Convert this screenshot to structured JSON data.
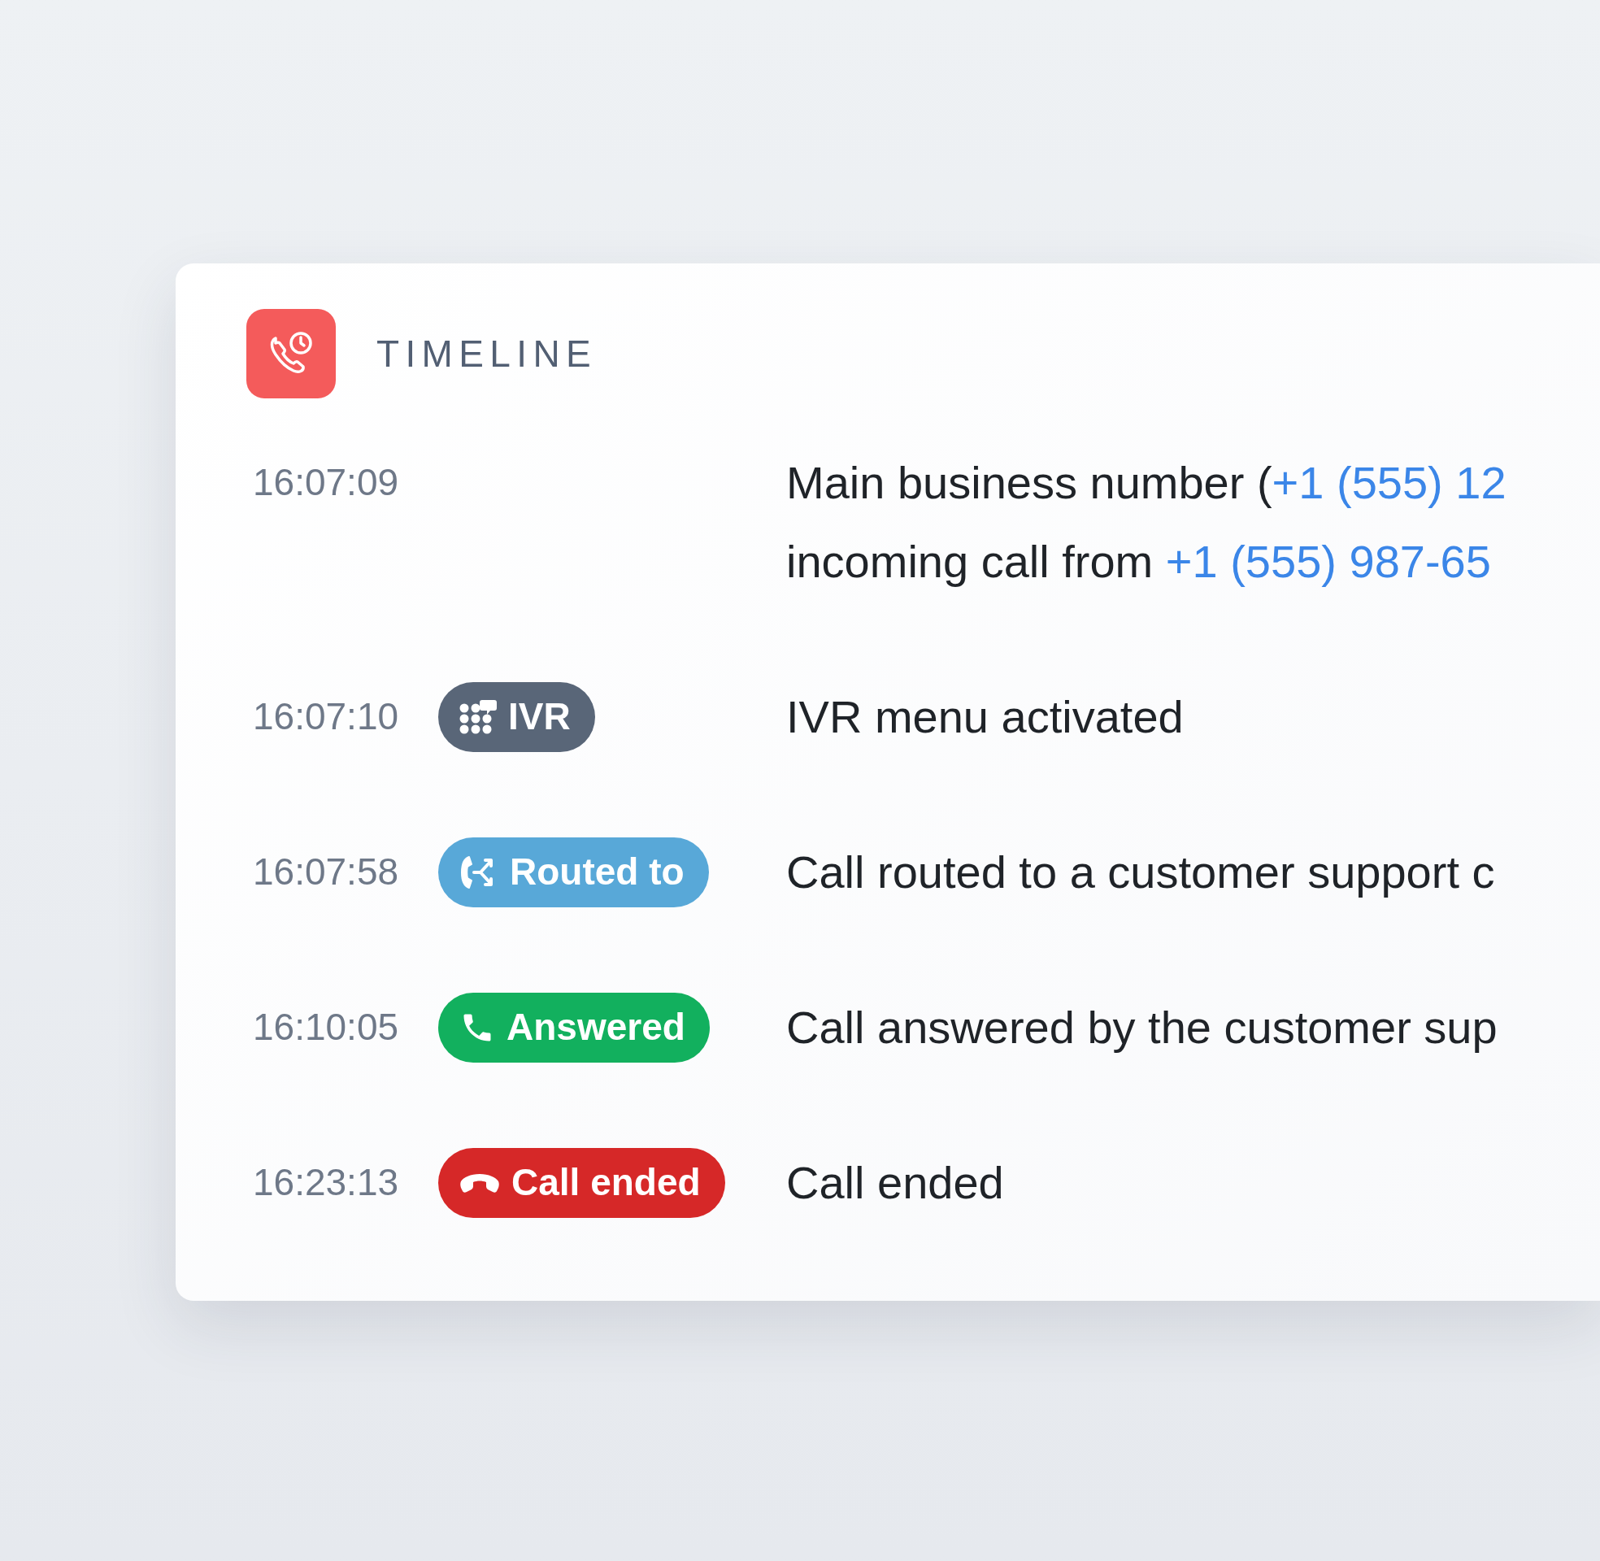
{
  "header": {
    "title": "TIMELINE"
  },
  "events": [
    {
      "time": "16:07:09",
      "lines": [
        [
          {
            "kind": "text",
            "text": "Main business number ("
          },
          {
            "kind": "phone",
            "text": "+1 (555) 12"
          }
        ],
        [
          {
            "kind": "text",
            "text": "incoming call from "
          },
          {
            "kind": "phone",
            "text": "+1 (555) 987-65"
          }
        ]
      ]
    },
    {
      "time": "16:07:10",
      "badge": {
        "kind": "ivr",
        "label": "IVR",
        "color": "#596678"
      },
      "lines": [
        [
          {
            "kind": "text",
            "text": "IVR menu activated"
          }
        ]
      ]
    },
    {
      "time": "16:07:58",
      "badge": {
        "kind": "routed",
        "label": "Routed to",
        "color": "#58a8d8"
      },
      "lines": [
        [
          {
            "kind": "text",
            "text": "Call routed to a customer support c"
          }
        ]
      ]
    },
    {
      "time": "16:10:05",
      "badge": {
        "kind": "answered",
        "label": "Answered",
        "color": "#12b05e"
      },
      "lines": [
        [
          {
            "kind": "text",
            "text": "Call answered by the customer sup"
          }
        ]
      ]
    },
    {
      "time": "16:23:13",
      "badge": {
        "kind": "ended",
        "label": "Call ended",
        "color": "#d62828"
      },
      "lines": [
        [
          {
            "kind": "text",
            "text": "Call ended"
          }
        ]
      ]
    }
  ]
}
